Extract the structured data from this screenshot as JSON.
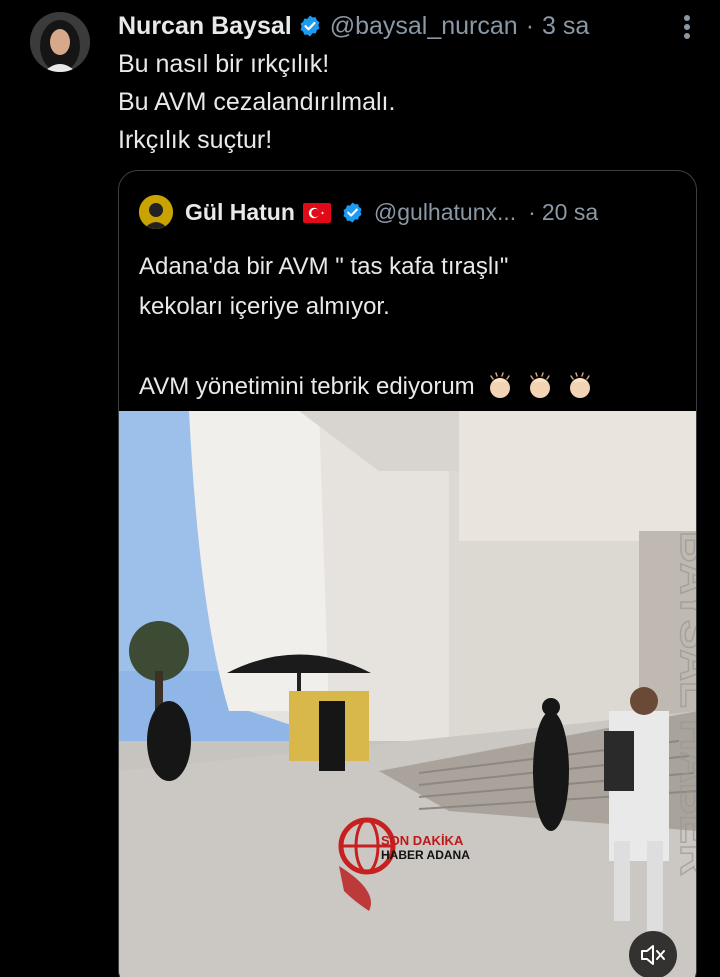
{
  "tweet": {
    "author_name": "Nurcan Baysal",
    "handle": "@baysal_nurcan",
    "separator": "·",
    "time": "3 sa",
    "lines": [
      "Bu nasıl bir ırkçılık!",
      "Bu AVM cezalandırılmalı.",
      "Irkçılık suçtur!"
    ]
  },
  "quote": {
    "author_name": "Gül Hatun",
    "handle": "@gulhatunx...",
    "separator": "·",
    "time": "20 sa",
    "lines": [
      "Adana'da bir AVM \" tas kafa tıraşlı\"",
      "kekoları içeriye almıyor.",
      "",
      "AVM yönetimini tebrik ediyorum"
    ],
    "video": {
      "watermark_line1": "SON DAKİKA",
      "watermark_line2": "HABER ADANA",
      "side_watermark": "BAYSAL HABER"
    }
  },
  "colors": {
    "background": "#000000",
    "text": "#e7e9ea",
    "muted": "#8b98a5",
    "verified": "#1d9bf0",
    "border": "#3a3f45"
  },
  "icons": {
    "verified": "verified-badge-icon",
    "more": "more-options-icon",
    "flag": "turkey-flag-icon",
    "clap": "clapping-hands-icon",
    "mute": "muted-speaker-icon"
  }
}
